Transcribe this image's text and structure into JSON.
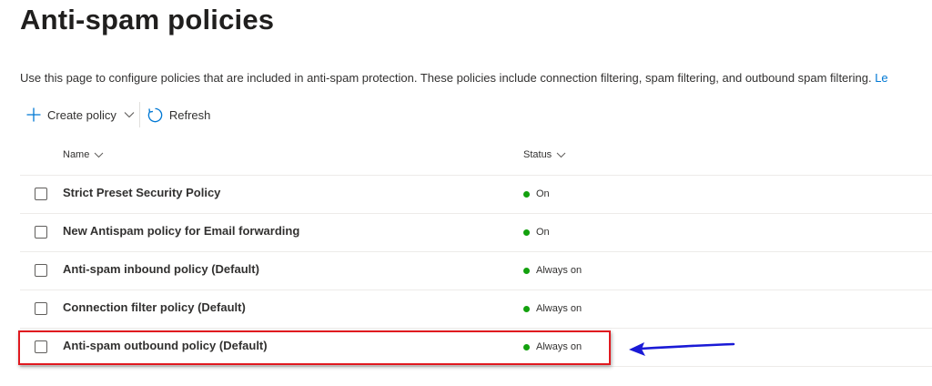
{
  "page": {
    "title": "Anti-spam policies",
    "description": "Use this page to configure policies that are included in anti-spam protection. These policies include connection filtering, spam filtering, and outbound spam filtering.",
    "learn_more_fragment": "Le"
  },
  "toolbar": {
    "create_policy_label": "Create policy",
    "refresh_label": "Refresh"
  },
  "table": {
    "columns": {
      "name": "Name",
      "status": "Status"
    },
    "rows": [
      {
        "name": "Strict Preset Security Policy",
        "status": "On"
      },
      {
        "name": "New Antispam policy for Email forwarding",
        "status": "On"
      },
      {
        "name": "Anti-spam inbound policy (Default)",
        "status": "Always on"
      },
      {
        "name": "Connection filter policy (Default)",
        "status": "Always on"
      },
      {
        "name": "Anti-spam outbound policy (Default)",
        "status": "Always on"
      }
    ]
  },
  "colors": {
    "status_on": "#13a10e",
    "highlight_border": "#e0191f",
    "annotation_arrow": "#1a1ad6",
    "accent": "#0078d4"
  },
  "icons": {
    "create": "plus-icon",
    "create_dropdown": "chevron-down-icon",
    "refresh": "refresh-icon",
    "sort": "chevron-down-icon"
  }
}
